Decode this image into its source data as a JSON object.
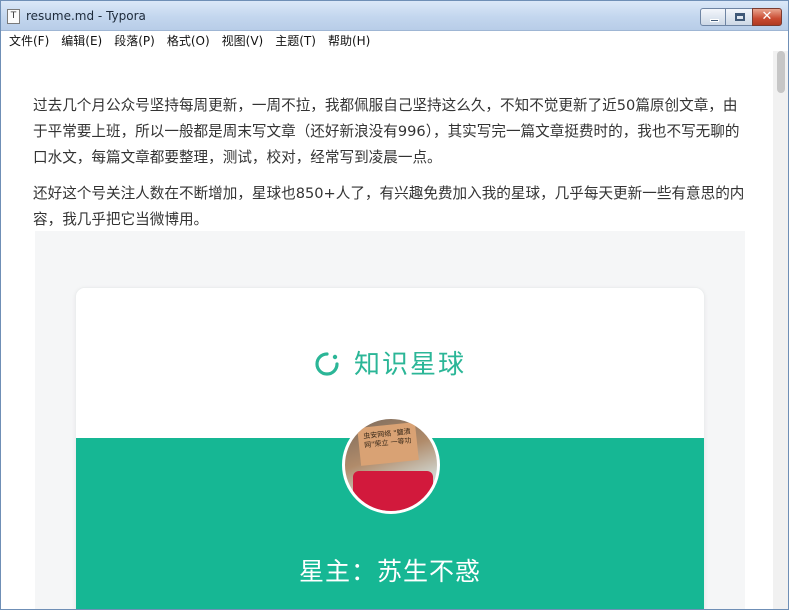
{
  "window": {
    "title": "resume.md - Typora",
    "app_icon_glyph": "T",
    "close_glyph": "✕"
  },
  "menu": [
    {
      "label": "文件(F)"
    },
    {
      "label": "编辑(E)"
    },
    {
      "label": "段落(P)"
    },
    {
      "label": "格式(O)"
    },
    {
      "label": "视图(V)"
    },
    {
      "label": "主题(T)"
    },
    {
      "label": "帮助(H)"
    }
  ],
  "document": {
    "paragraph_1": "过去几个月公众号坚持每周更新，一周不拉，我都佩服自己坚持这么久，不知不觉更新了近50篇原创文章，由于平常要上班，所以一般都是周末写文章（还好新浪没有996），其实写完一篇文章挺费时的，我也不写无聊的口水文，每篇文章都要整理，测试，校对，经常写到凌晨一点。",
    "paragraph_2": "还好这个号关注人数在不断增加，星球也850+人了，有兴趣免费加入我的星球，几乎每天更新一些有意思的内容，我几乎把它当微博用。"
  },
  "image_card": {
    "brand": "知识星球",
    "owner": "星主：苏生不惑",
    "avatar_sign": "虫安网络 \"鹽漬网\"荣立 一等功",
    "accent_color": "#16b794",
    "brand_color": "#2bb697"
  },
  "icons": {
    "app": "typora-icon",
    "minimize": "minimize-icon",
    "maximize": "maximize-icon",
    "close": "close-icon",
    "brand": "planet-logo-icon"
  }
}
